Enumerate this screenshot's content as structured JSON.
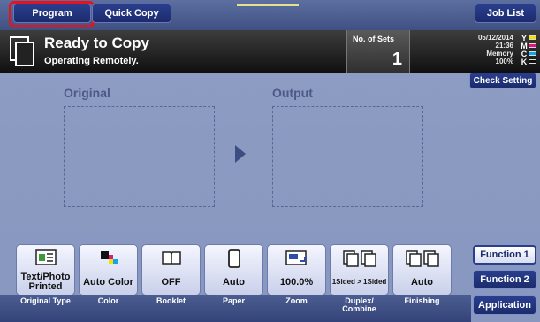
{
  "tabs": {
    "program": "Program",
    "quick_copy": "Quick Copy",
    "job_list": "Job List"
  },
  "status": {
    "title": "Ready to Copy",
    "subtitle": "Operating Remotely.",
    "sets_label": "No. of Sets",
    "sets_value": "1",
    "date": "05/12/2014",
    "time": "21:36",
    "memory_label": "Memory",
    "memory_value": "100%",
    "toner": [
      {
        "letter": "Y",
        "color": "#f2e400"
      },
      {
        "letter": "M",
        "color": "#e0157f"
      },
      {
        "letter": "C",
        "color": "#12a5e6"
      },
      {
        "letter": "K",
        "color": "#111111"
      }
    ]
  },
  "check_setting": "Check Setting",
  "main": {
    "original_label": "Original",
    "output_label": "Output"
  },
  "functions": [
    {
      "value": "Text/Photo Printed",
      "caption": "Original Type",
      "icon": "original-type-icon"
    },
    {
      "value": "Auto Color",
      "caption": "Color",
      "icon": "color-icon"
    },
    {
      "value": "OFF",
      "caption": "Booklet",
      "icon": "booklet-icon"
    },
    {
      "value": "Auto",
      "caption": "Paper",
      "icon": "paper-icon"
    },
    {
      "value": "100.0%",
      "caption": "Zoom",
      "icon": "zoom-icon"
    },
    {
      "value": "1Sided > 1Sided",
      "caption": "Duplex/ Combine",
      "icon": "duplex-icon"
    },
    {
      "value": "Auto",
      "caption": "Finishing",
      "icon": "finishing-icon"
    }
  ],
  "side_buttons": {
    "function1": "Function 1",
    "function2": "Function 2",
    "application": "Application"
  }
}
